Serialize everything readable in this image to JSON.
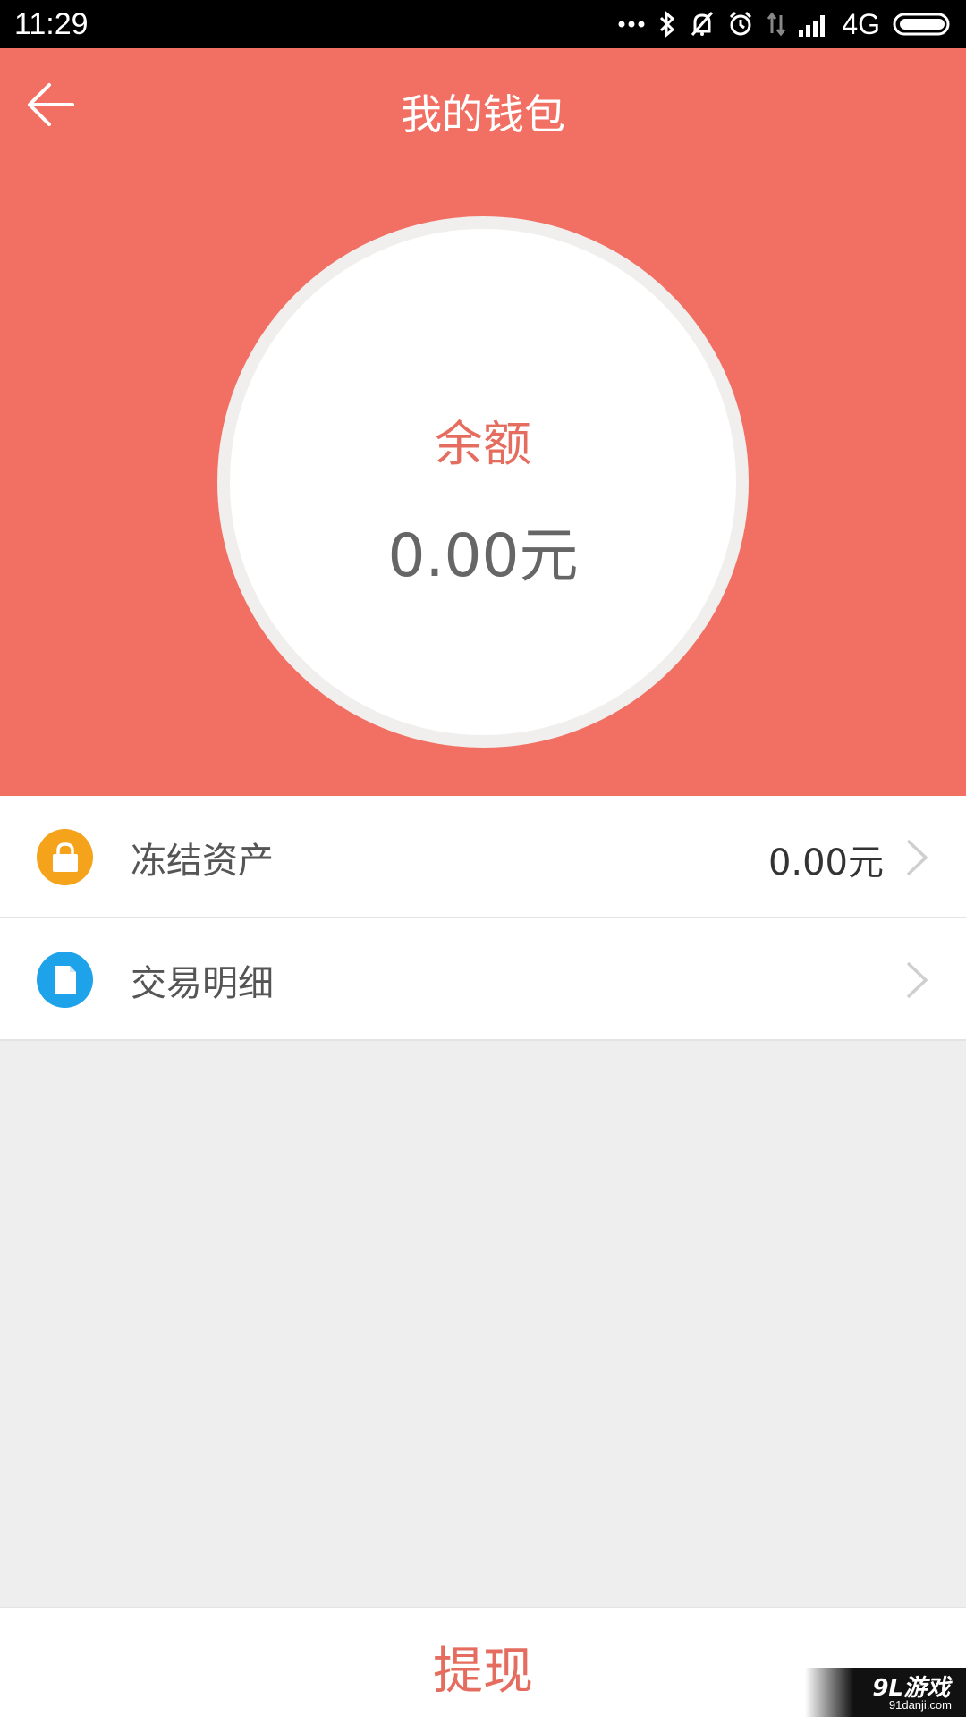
{
  "status_bar": {
    "time": "11:29",
    "network": "4G",
    "icons": [
      "more-icon",
      "bluetooth-icon",
      "mute-icon",
      "alarm-icon",
      "data-icon",
      "signal-icon",
      "battery-icon"
    ]
  },
  "header": {
    "title": "我的钱包",
    "back_icon": "back-arrow-icon",
    "background_color": "#f17063"
  },
  "balance": {
    "label": "余额",
    "amount": "0.00元"
  },
  "list": {
    "items": [
      {
        "label": "冻结资产",
        "value": "0.00元",
        "icon": "lock-icon",
        "icon_color": "#f4a31a"
      },
      {
        "label": "交易明细",
        "value": "",
        "icon": "document-icon",
        "icon_color": "#1ea2ea"
      }
    ]
  },
  "footer": {
    "withdraw_label": "提现"
  },
  "watermark": {
    "main": "9L游戏",
    "sub": "91danji.com"
  }
}
